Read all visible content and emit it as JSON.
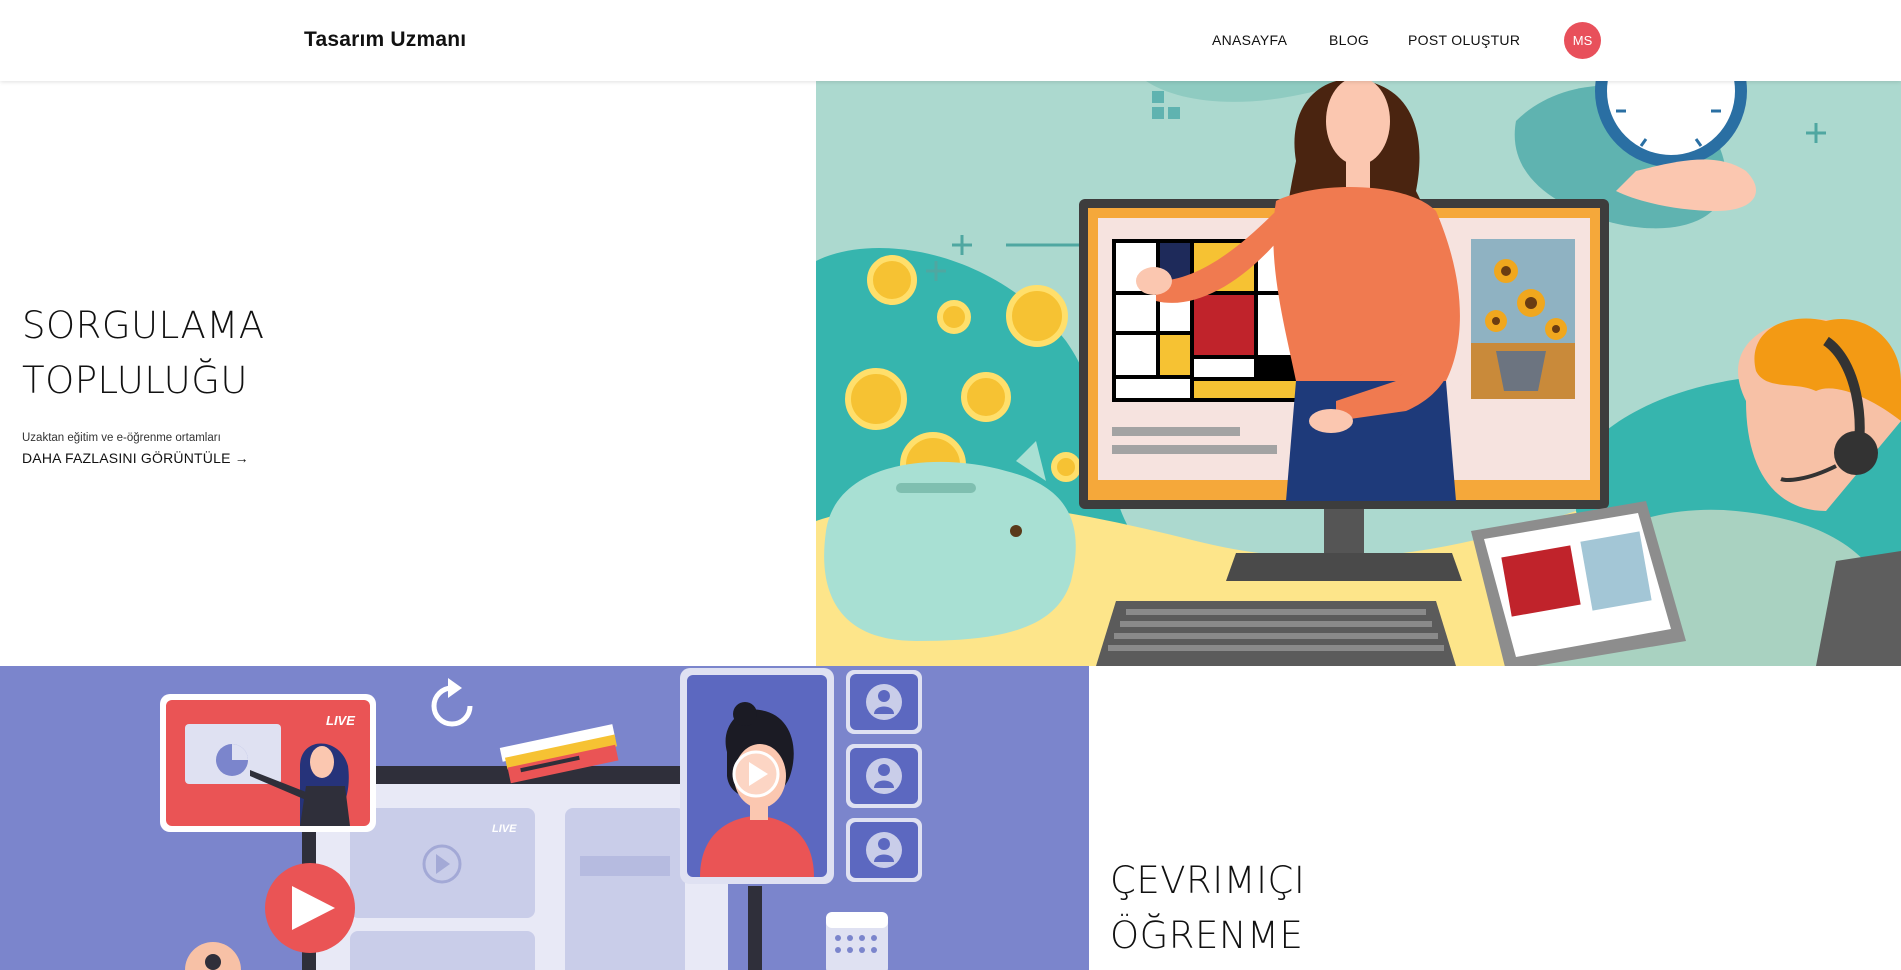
{
  "header": {
    "brand": "Tasarım Uzmanı",
    "nav": {
      "home": "ANASAYFA",
      "blog": "BLOG",
      "create_post": "POST OLUŞTUR"
    },
    "avatar_initials": "MS",
    "avatar_color": "#e8505b"
  },
  "hero1": {
    "title_line1": "SORGULAMA",
    "title_line2": "TOPLULUĞU",
    "subtitle": "Uzaktan eğitim ve e-öğrenme ortamları",
    "link_label": "DAHA FAZLASINI GÖRÜNTÜLE",
    "link_icon": "arrow-right-icon"
  },
  "hero2": {
    "title_line1": "ÇEVRIMIÇI",
    "title_line2": "ÖĞRENME"
  },
  "illustration2": {
    "live_badge": "LIVE",
    "live_badge_small": "LIVE"
  },
  "colors": {
    "accent": "#e8505b",
    "illus1_bg": "#acd9cf",
    "illus2_bg": "#7b85cc"
  }
}
